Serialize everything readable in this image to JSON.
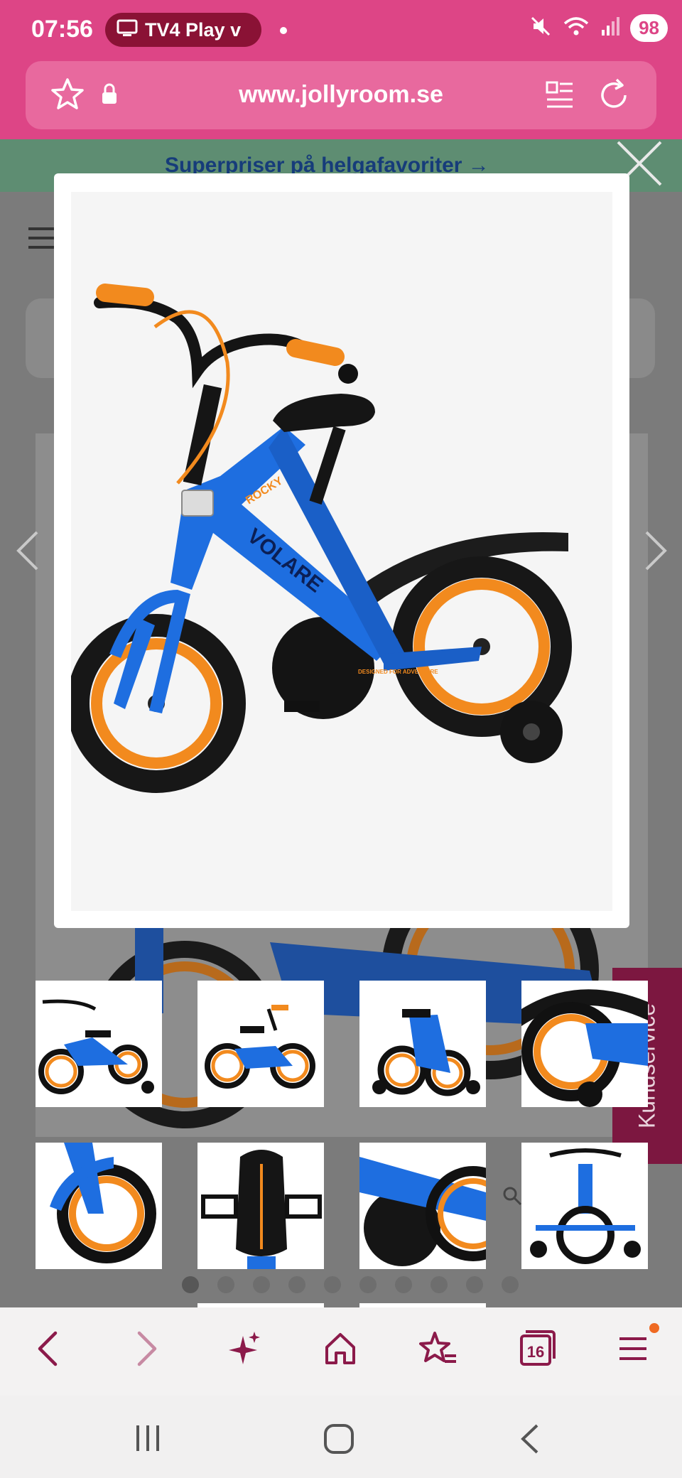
{
  "status_bar": {
    "time": "07:56",
    "tv_chip_label": "TV4 Play v",
    "battery": "98"
  },
  "url_bar": {
    "url": "www.jollyroom.se"
  },
  "page": {
    "promo_text": "Superpriser på helgafavoriter →",
    "kundservice_label": "Kundservice"
  },
  "modal": {
    "bike": {
      "brand": "VOLARE",
      "model": "ROCKY",
      "chainguard_text": "DESIGNED FOR ADVENTURE"
    }
  },
  "gallery": {
    "thumb_count": 8,
    "dot_count": 10,
    "active_dot": 0
  },
  "bottom_toolbar": {
    "tab_count": "16"
  },
  "colors": {
    "brand_pink": "#dd4586",
    "url_bar_pink": "#e8699e",
    "accent_maroon": "#8a1235",
    "promo_green": "#5e8d72",
    "bike_blue": "#1e6ee0",
    "bike_orange": "#f28a1e",
    "toolbar_icon": "#8b1a4a",
    "notification_dot": "#ef6a22"
  }
}
